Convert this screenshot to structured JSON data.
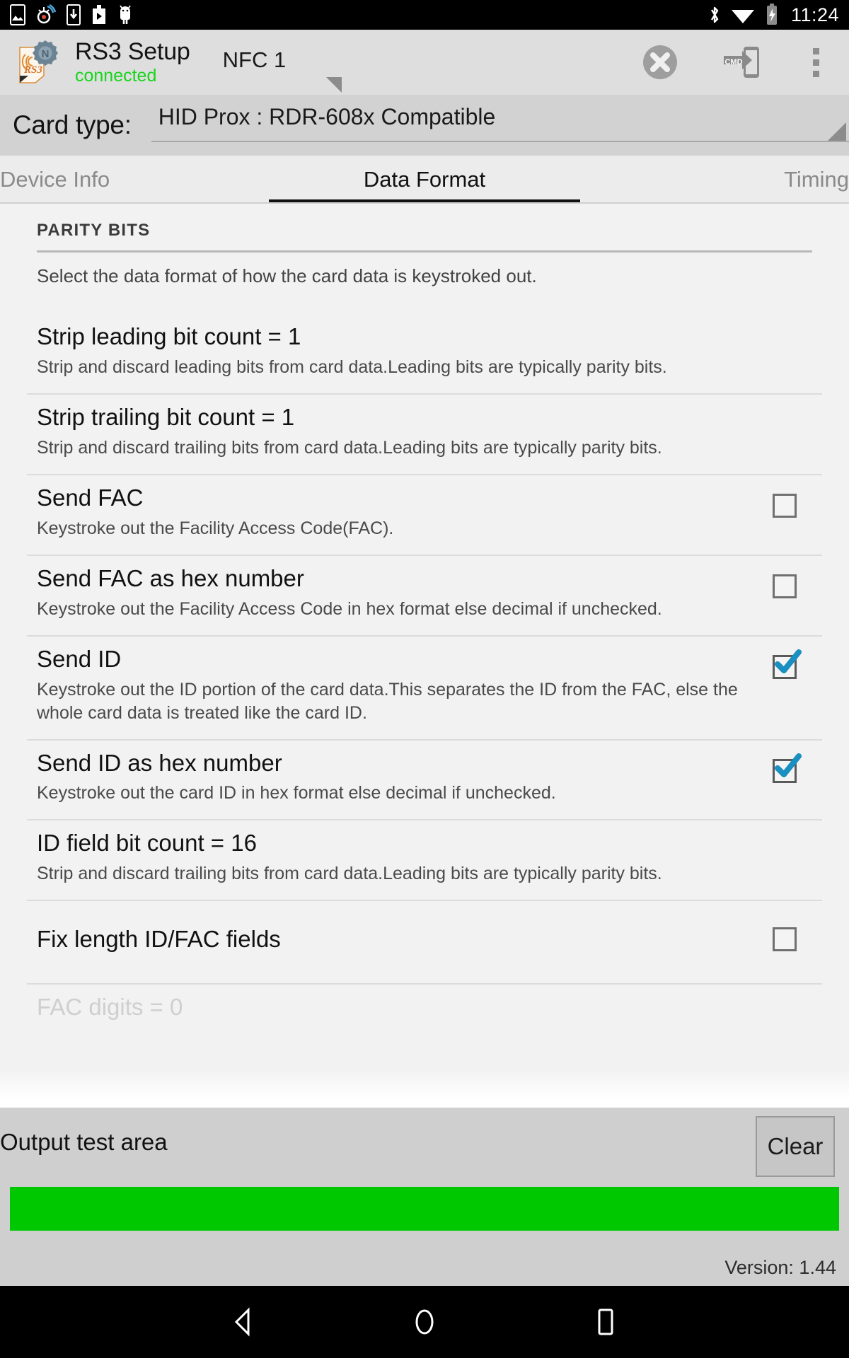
{
  "status_bar": {
    "time": "11:24",
    "left_icons": [
      "screenshot-icon",
      "settings-sync-icon",
      "download-icon",
      "app-install-icon",
      "android-icon"
    ],
    "right_icons": [
      "bluetooth-icon",
      "wifi-icon",
      "battery-charging-icon"
    ]
  },
  "action_bar": {
    "app_title": "RS3 Setup",
    "connection_status": "connected",
    "device_spinner_value": "NFC 1",
    "actions": [
      "disconnect-icon",
      "cmd-icon",
      "overflow-menu-icon"
    ]
  },
  "card_type": {
    "label": "Card type:",
    "value": "HID Prox : RDR-608x Compatible"
  },
  "tabs": [
    {
      "label": "Device Info",
      "selected": false
    },
    {
      "label": "Data Format",
      "selected": true
    },
    {
      "label": "Timing",
      "selected": false
    }
  ],
  "section": {
    "title": "PARITY BITS",
    "description": "Select the data format of how the card data is keystroked out."
  },
  "settings": [
    {
      "title": "Strip leading bit count = 1",
      "summary": "Strip and discard leading bits from card data.Leading bits are typically parity bits.",
      "control": "none"
    },
    {
      "title": "Strip trailing bit count = 1",
      "summary": "Strip and discard trailing bits from card data.Leading bits are typically parity bits.",
      "control": "none"
    },
    {
      "title": "Send FAC",
      "summary": "Keystroke out the Facility Access Code(FAC).",
      "control": "checkbox",
      "checked": false
    },
    {
      "title": "Send FAC as hex number",
      "summary": "Keystroke out the Facility Access Code in hex format else decimal if unchecked.",
      "control": "checkbox",
      "checked": false
    },
    {
      "title": "Send ID",
      "summary": "Keystroke out the ID portion of the card data.This separates the ID from the FAC, else the whole card data is treated like the card ID.",
      "control": "checkbox",
      "checked": true
    },
    {
      "title": "Send ID as hex number",
      "summary": "Keystroke out the card ID in hex format else decimal if unchecked.",
      "control": "checkbox",
      "checked": true
    },
    {
      "title": "ID field bit count = 16",
      "summary": "Strip and discard trailing bits from card data.Leading bits are typically parity bits.",
      "control": "none"
    },
    {
      "title": "Fix length ID/FAC fields",
      "summary": "",
      "control": "checkbox",
      "checked": false
    },
    {
      "title": "FAC digits = 0",
      "summary": "",
      "control": "none",
      "clipped": true
    }
  ],
  "output_panel": {
    "label": "Output test area",
    "clear_label": "Clear",
    "field_value": "",
    "field_color": "#00c800",
    "version": "Version: 1.44"
  },
  "nav_bar": {
    "back": "back-icon",
    "home": "home-icon",
    "recents": "recents-icon"
  },
  "colors": {
    "accent_checkbox": "#1a8fc1",
    "connected_green": "#16d51a",
    "output_green": "#00c800",
    "action_bar_bg": "#dedede",
    "card_type_bg": "#d2d2d2"
  }
}
